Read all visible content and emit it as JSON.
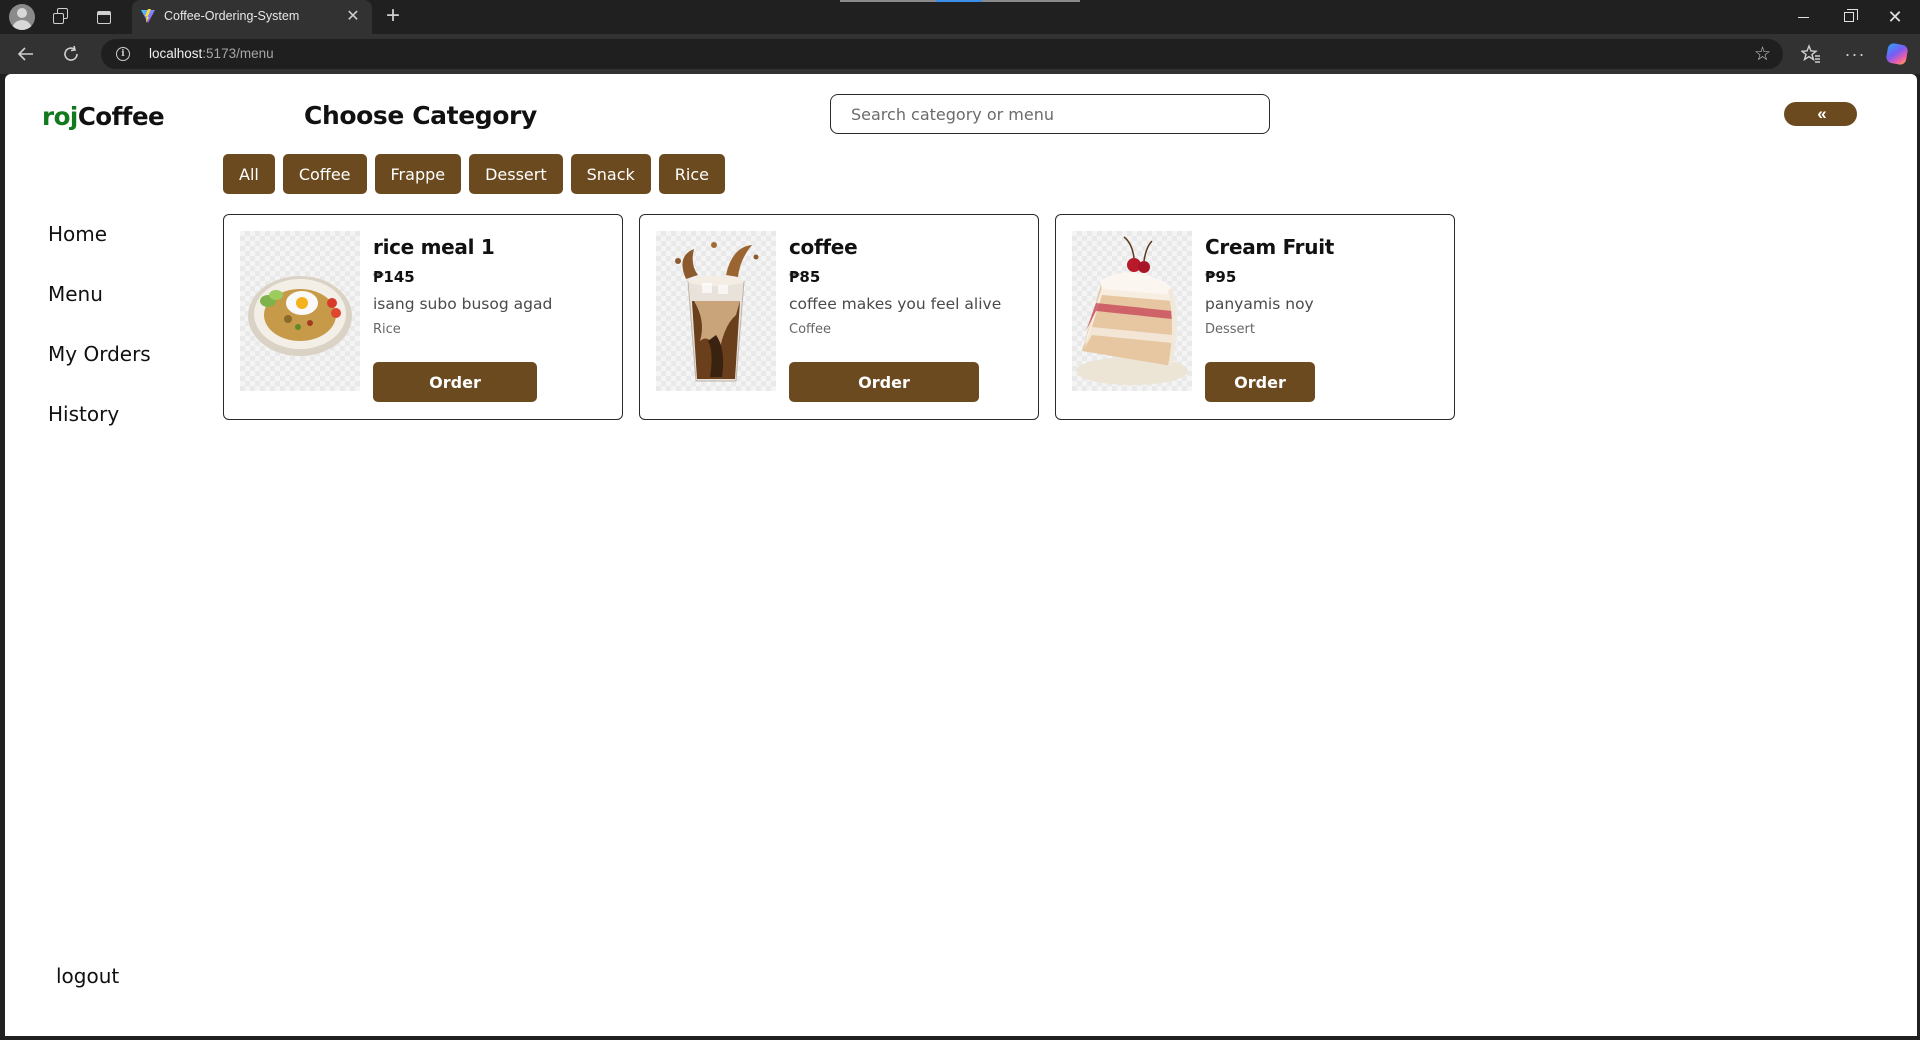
{
  "browser": {
    "tab_title": "Coffee-Ordering-System",
    "url_host": "localhost",
    "url_path": ":5173/menu"
  },
  "app": {
    "brand_prefix": "roj",
    "brand_suffix": "Coffee",
    "page_title": "Choose Category",
    "search_placeholder": "Search category or menu",
    "collapse_label": "«",
    "colors": {
      "accent": "#6b4a1f",
      "brand_green": "#13791f"
    }
  },
  "categories": [
    "All",
    "Coffee",
    "Frappe",
    "Dessert",
    "Snack",
    "Rice"
  ],
  "nav": {
    "items": [
      "Home",
      "Menu",
      "My Orders",
      "History"
    ],
    "logout": "logout"
  },
  "menu_items": [
    {
      "name": "rice meal 1",
      "price": "₱145",
      "description": "isang subo busog agad",
      "category": "Rice",
      "order_label": "Order",
      "image": "rice-meal-image"
    },
    {
      "name": "coffee",
      "price": "₱85",
      "description": "coffee makes you feel alive",
      "category": "Coffee",
      "order_label": "Order",
      "image": "iced-coffee-image"
    },
    {
      "name": "Cream Fruit",
      "price": "₱95",
      "description": "panyamis noy",
      "category": "Dessert",
      "order_label": "Order",
      "image": "cake-slice-image"
    }
  ]
}
